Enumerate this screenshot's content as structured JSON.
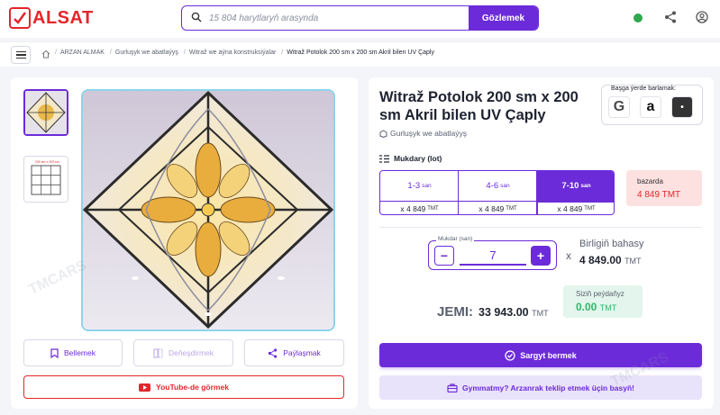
{
  "brand": {
    "name": "ALSAT",
    "accent": "#6c2bd9",
    "brand_color": "#e3262b"
  },
  "search": {
    "placeholder": "15 804 harytlaryň arasynda",
    "button_label": "Gözlemek"
  },
  "header": {
    "status_color": "#2fa84f",
    "icons": [
      "share-icon",
      "user-icon"
    ]
  },
  "breadcrumbs": [
    "ARZAN ALMAK",
    "Gurluşyk we abatlaýyş",
    "Witraž we aýna konstruksiýalar",
    "Witraž Potolok 200 sm x 200 sm Akril bilen UV Çaply"
  ],
  "gallery": {
    "thumbnails": [
      "stained-glass-ceiling-photo",
      "drawing-sketch"
    ],
    "sketch_note": "200 sm x 200 sm",
    "actions": {
      "save": "Bellemek",
      "compare": "Deňeşdirmek",
      "share": "Paýlaşmak",
      "youtube": "YouTube-de görmek"
    }
  },
  "product": {
    "title": "Witraž Potolok 200 sm x 200 sm Akril bilen UV Çaply",
    "category": "Gurluşyk we abatlaýyş",
    "compare_label": "Başga ýerde barlamak:",
    "compare_stores": [
      "G",
      "a",
      "•"
    ]
  },
  "pricing": {
    "qty_label": "Mukdary (lot)",
    "tiers": [
      {
        "range": "1-3",
        "unit": "san",
        "price": "x 4 849",
        "currency": "TMT",
        "active": false
      },
      {
        "range": "4-6",
        "unit": "san",
        "price": "x 4 849",
        "currency": "TMT",
        "active": false
      },
      {
        "range": "7-10",
        "unit": "san",
        "price": "x 4 849",
        "currency": "TMT",
        "active": true
      }
    ],
    "market": {
      "label": "bazarda",
      "price": "4 849 TMT"
    }
  },
  "order": {
    "qty_field_label": "Mukdar (san)",
    "quantity": "7",
    "minus": "−",
    "plus": "+",
    "times": "x",
    "unit_label": "Birligiň bahasy",
    "unit_price": "4 849.00",
    "currency": "TMT",
    "total_label": "JEMI:",
    "total": "33 943.00",
    "saving_label": "Siziň peýdaňyz",
    "saving": "0.00",
    "order_button": "Sargyt bermek",
    "cheaper_button": "Gymmatmy? Arzanrak teklip etmek üçin basyň!"
  },
  "watermark": "TMCARS"
}
